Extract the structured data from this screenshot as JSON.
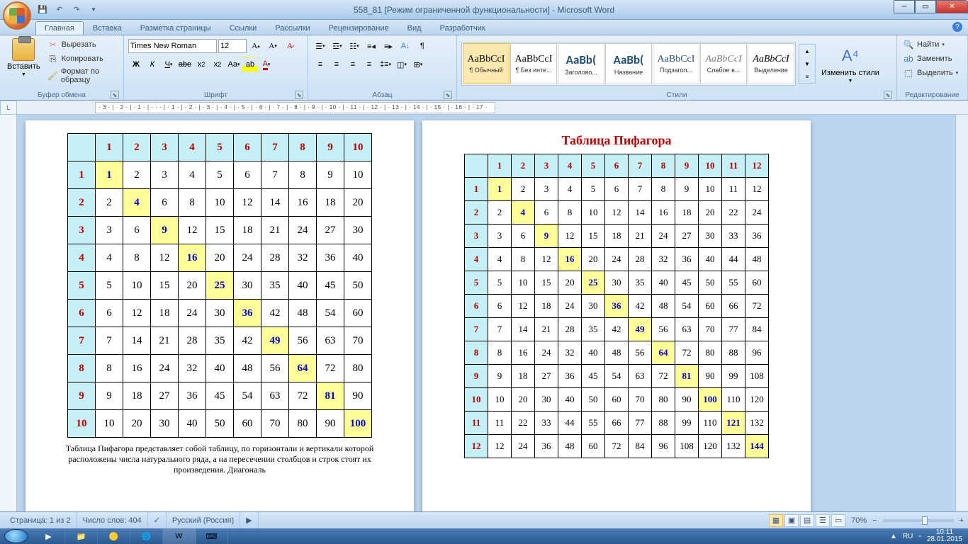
{
  "title": "558_81 [Режим ограниченной функциональности] - Microsoft Word",
  "tabs": [
    "Главная",
    "Вставка",
    "Разметка страницы",
    "Ссылки",
    "Рассылки",
    "Рецензирование",
    "Вид",
    "Разработчик"
  ],
  "clipboard": {
    "paste": "Вставить",
    "cut": "Вырезать",
    "copy": "Копировать",
    "format": "Формат по образцу",
    "label": "Буфер обмена"
  },
  "font": {
    "family": "Times New Roman",
    "size": "12",
    "label": "Шрифт"
  },
  "para": {
    "label": "Абзац"
  },
  "styles": {
    "items": [
      {
        "sample": "AaBbCcI",
        "name": "¶ Обычный",
        "fam": "serif",
        "ital": false,
        "color": "#000"
      },
      {
        "sample": "AaBbCcI",
        "name": "¶ Без инте...",
        "fam": "serif",
        "ital": false,
        "color": "#000"
      },
      {
        "sample": "AaBb(",
        "name": "Заголово...",
        "fam": "sans",
        "ital": false,
        "color": "#1f4e79",
        "bold": true,
        "big": true
      },
      {
        "sample": "AaBb(",
        "name": "Название",
        "fam": "sans",
        "ital": false,
        "color": "#1f4e79",
        "bold": true,
        "big": true
      },
      {
        "sample": "AaBbCcI",
        "name": "Подзагол...",
        "fam": "serif",
        "ital": false,
        "color": "#1f4e79"
      },
      {
        "sample": "AaBbCcI",
        "name": "Слабое в...",
        "fam": "serif",
        "ital": true,
        "color": "#808080"
      },
      {
        "sample": "AaBbCcI",
        "name": "Выделение",
        "fam": "serif",
        "ital": true,
        "color": "#000"
      }
    ],
    "change": "Изменить стили",
    "label": "Стили"
  },
  "editing": {
    "find": "Найти",
    "replace": "Заменить",
    "select": "Выделить",
    "label": "Редактирование"
  },
  "ruler": "· 3 · | · 2 · | · 1 · | · · · | · 1 · | · 2 · | · 3 · | · 4 · | · 5 · | · 6 · | · 7 · | · 8 · | · 9 · | · 10 · | · 11 · | · 12 · | · 13 · | · 14 · | · 15 · | · 16 · | · 17 ·",
  "doc": {
    "page2_title": "Таблица Пифагора",
    "caption": "Таблица Пифагора представляет собой таблицу, по горизонтали и вертикали которой расположены числа натурального ряда, а на пересечении столбцов и строк стоят их произведения. Диагональ",
    "table1_size": 10,
    "table2_size": 12
  },
  "status": {
    "page": "Страница: 1 из 2",
    "words": "Число слов: 404",
    "lang": "Русский (Россия)",
    "zoom": "70%"
  },
  "tray": {
    "lang": "RU",
    "time": "10:11",
    "date": "28.01.2015"
  }
}
